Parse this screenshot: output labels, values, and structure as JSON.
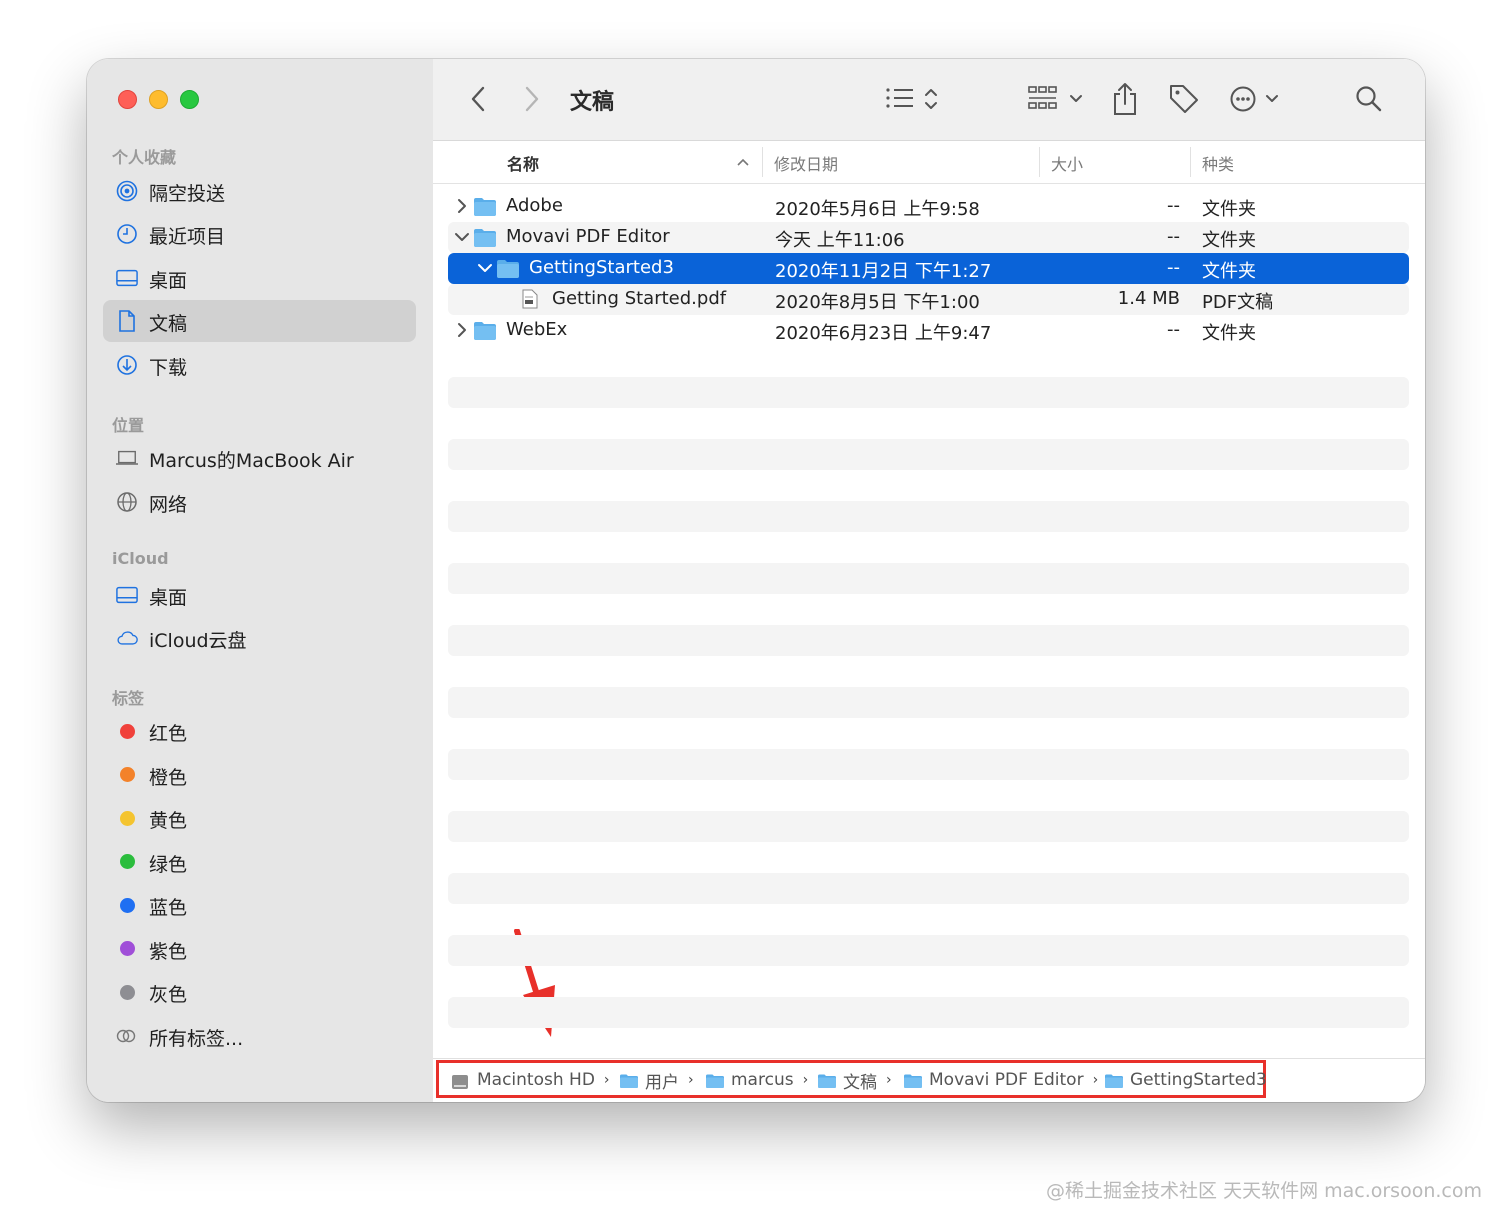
{
  "window": {
    "title": "文稿"
  },
  "sidebar": {
    "favorites_header": "个人收藏",
    "favorites": [
      {
        "label": "隔空投送",
        "icon": "airdrop-icon"
      },
      {
        "label": "最近项目",
        "icon": "clock-icon"
      },
      {
        "label": "桌面",
        "icon": "desktop-icon"
      },
      {
        "label": "文稿",
        "icon": "document-icon",
        "selected": true
      },
      {
        "label": "下载",
        "icon": "download-icon"
      }
    ],
    "locations_header": "位置",
    "locations": [
      {
        "label": "Marcus的MacBook Air",
        "icon": "laptop-icon"
      },
      {
        "label": "网络",
        "icon": "globe-icon"
      }
    ],
    "icloud_header": "iCloud",
    "icloud": [
      {
        "label": "桌面",
        "icon": "desktop-icon"
      },
      {
        "label": "iCloud云盘",
        "icon": "cloud-icon"
      }
    ],
    "tags_header": "标签",
    "tags": [
      {
        "label": "红色",
        "color": "#f0413b"
      },
      {
        "label": "橙色",
        "color": "#f3822a"
      },
      {
        "label": "黄色",
        "color": "#f4c430"
      },
      {
        "label": "绿色",
        "color": "#2bbd3d"
      },
      {
        "label": "蓝色",
        "color": "#1f6ff2"
      },
      {
        "label": "紫色",
        "color": "#a04fd8"
      },
      {
        "label": "灰色",
        "color": "#8e8e93"
      },
      {
        "label": "所有标签...",
        "color": ""
      }
    ]
  },
  "columns": {
    "name": "名称",
    "date": "修改日期",
    "size": "大小",
    "kind": "种类"
  },
  "files": [
    {
      "name": "Adobe",
      "date": "2020年5月6日 上午9:58",
      "size": "--",
      "kind": "文件夹",
      "type": "folder",
      "level": 0,
      "expanded": false
    },
    {
      "name": "Movavi PDF Editor",
      "date": "今天 上午11:06",
      "size": "--",
      "kind": "文件夹",
      "type": "folder",
      "level": 0,
      "expanded": true
    },
    {
      "name": "GettingStarted3",
      "date": "2020年11月2日 下午1:27",
      "size": "--",
      "kind": "文件夹",
      "type": "folder",
      "level": 1,
      "expanded": true,
      "selected": true
    },
    {
      "name": "Getting Started.pdf",
      "date": "2020年8月5日 下午1:00",
      "size": "1.4 MB",
      "kind": "PDF文稿",
      "type": "pdf",
      "level": 2
    },
    {
      "name": "WebEx",
      "date": "2020年6月23日 上午9:47",
      "size": "--",
      "kind": "文件夹",
      "type": "folder",
      "level": 0,
      "expanded": false
    }
  ],
  "pathbar": [
    {
      "label": "Macintosh HD",
      "icon": "harddisk-icon"
    },
    {
      "label": "用户",
      "icon": "folder-icon"
    },
    {
      "label": "marcus",
      "icon": "home-folder-icon"
    },
    {
      "label": "文稿",
      "icon": "folder-icon"
    },
    {
      "label": "Movavi PDF Editor",
      "icon": "folder-icon"
    },
    {
      "label": "GettingStarted3",
      "icon": "folder-icon"
    }
  ],
  "annotation": {
    "arrow_color": "#e8302a",
    "highlight_color": "#e8302a"
  },
  "watermark": "@稀土掘金技术社区 天天软件网 mac.orsoon.com"
}
